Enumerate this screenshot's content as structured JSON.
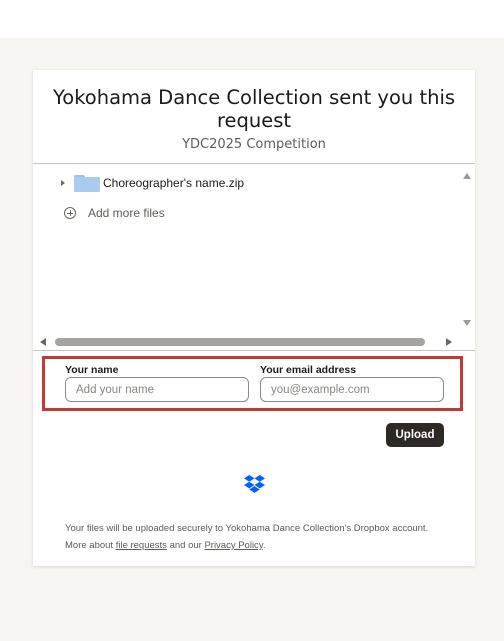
{
  "request": {
    "title": "Yokohama Dance Collection sent you this request",
    "subtitle": "YDC2025 Competition"
  },
  "files": {
    "items": [
      {
        "name": "Choreographer's name.zip",
        "icon": "folder-icon"
      }
    ],
    "add_more_label": "Add more files"
  },
  "form": {
    "name_label": "Your name",
    "name_placeholder": "Add your name",
    "name_value": "",
    "email_label": "Your email address",
    "email_placeholder": "you@example.com",
    "email_value": "",
    "upload_label": "Upload"
  },
  "footer": {
    "text_1": "Your files will be uploaded securely to Yokohama Dance Collection's Dropbox account. More about ",
    "link_file_requests": "file requests",
    "text_2": " and our ",
    "link_privacy": "Privacy Policy",
    "text_3": "."
  },
  "colors": {
    "highlight": "#c03a36",
    "button_bg": "#2d2a26",
    "dropbox_blue": "#0061fe"
  }
}
